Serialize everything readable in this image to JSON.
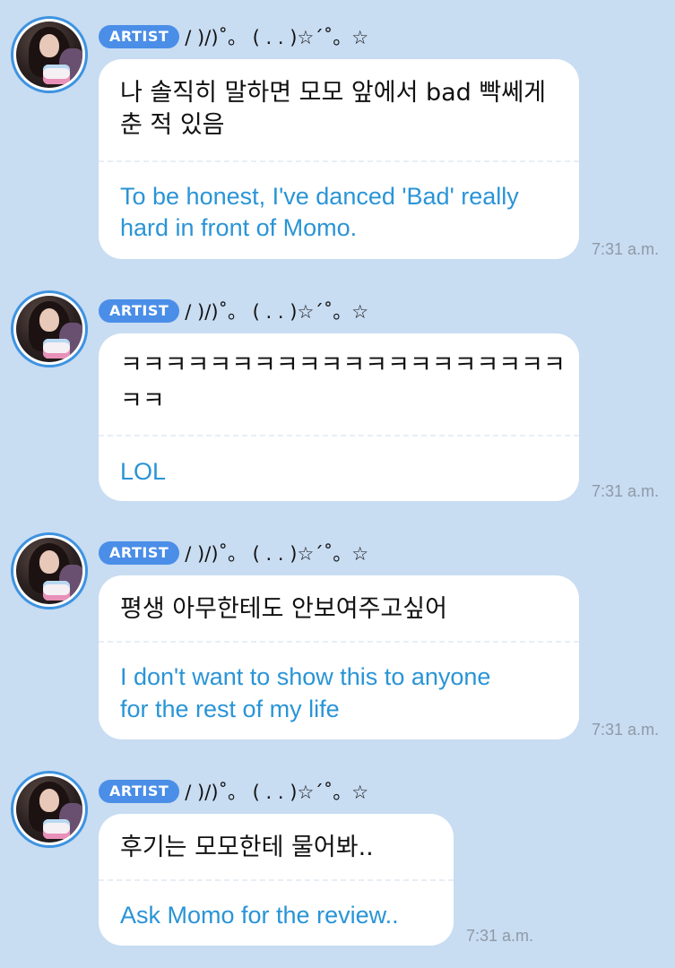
{
  "messages": [
    {
      "badge": "ARTIST",
      "nickname": "/ )/)˚。 ( . . )☆´˚。☆",
      "korean": [
        "나 솔직히 말하면 모모 앞에서 bad 빡쎄게",
        "춘 적 있음"
      ],
      "english": [
        "To be honest, I've danced 'Bad' really",
        "hard in front of Momo."
      ],
      "time": "7:31 a.m."
    },
    {
      "badge": "ARTIST",
      "nickname": "/ )/)˚。 ( . . )☆´˚。☆",
      "korean": [
        " ㅋㅋㅋㅋㅋㅋㅋㅋㅋㅋㅋㅋㅋㅋㅋㅋㅋㅋㅋㅋ",
        "ㅋㅋ"
      ],
      "english": [
        "LOL"
      ],
      "time": "7:31 a.m."
    },
    {
      "badge": "ARTIST",
      "nickname": "/ )/)˚。 ( . . )☆´˚。☆",
      "korean": [
        " 평생 아무한테도 안보여주고싶어"
      ],
      "english": [
        "I don't want to show this to anyone",
        "for the rest of my life"
      ],
      "time": "7:31 a.m."
    },
    {
      "badge": "ARTIST",
      "nickname": "/ )/)˚。 ( . . )☆´˚。☆",
      "korean": [
        "후기는 모모한테 물어봐.."
      ],
      "english": [
        "Ask Momo for the review.."
      ],
      "time": "7:31 a.m."
    }
  ]
}
